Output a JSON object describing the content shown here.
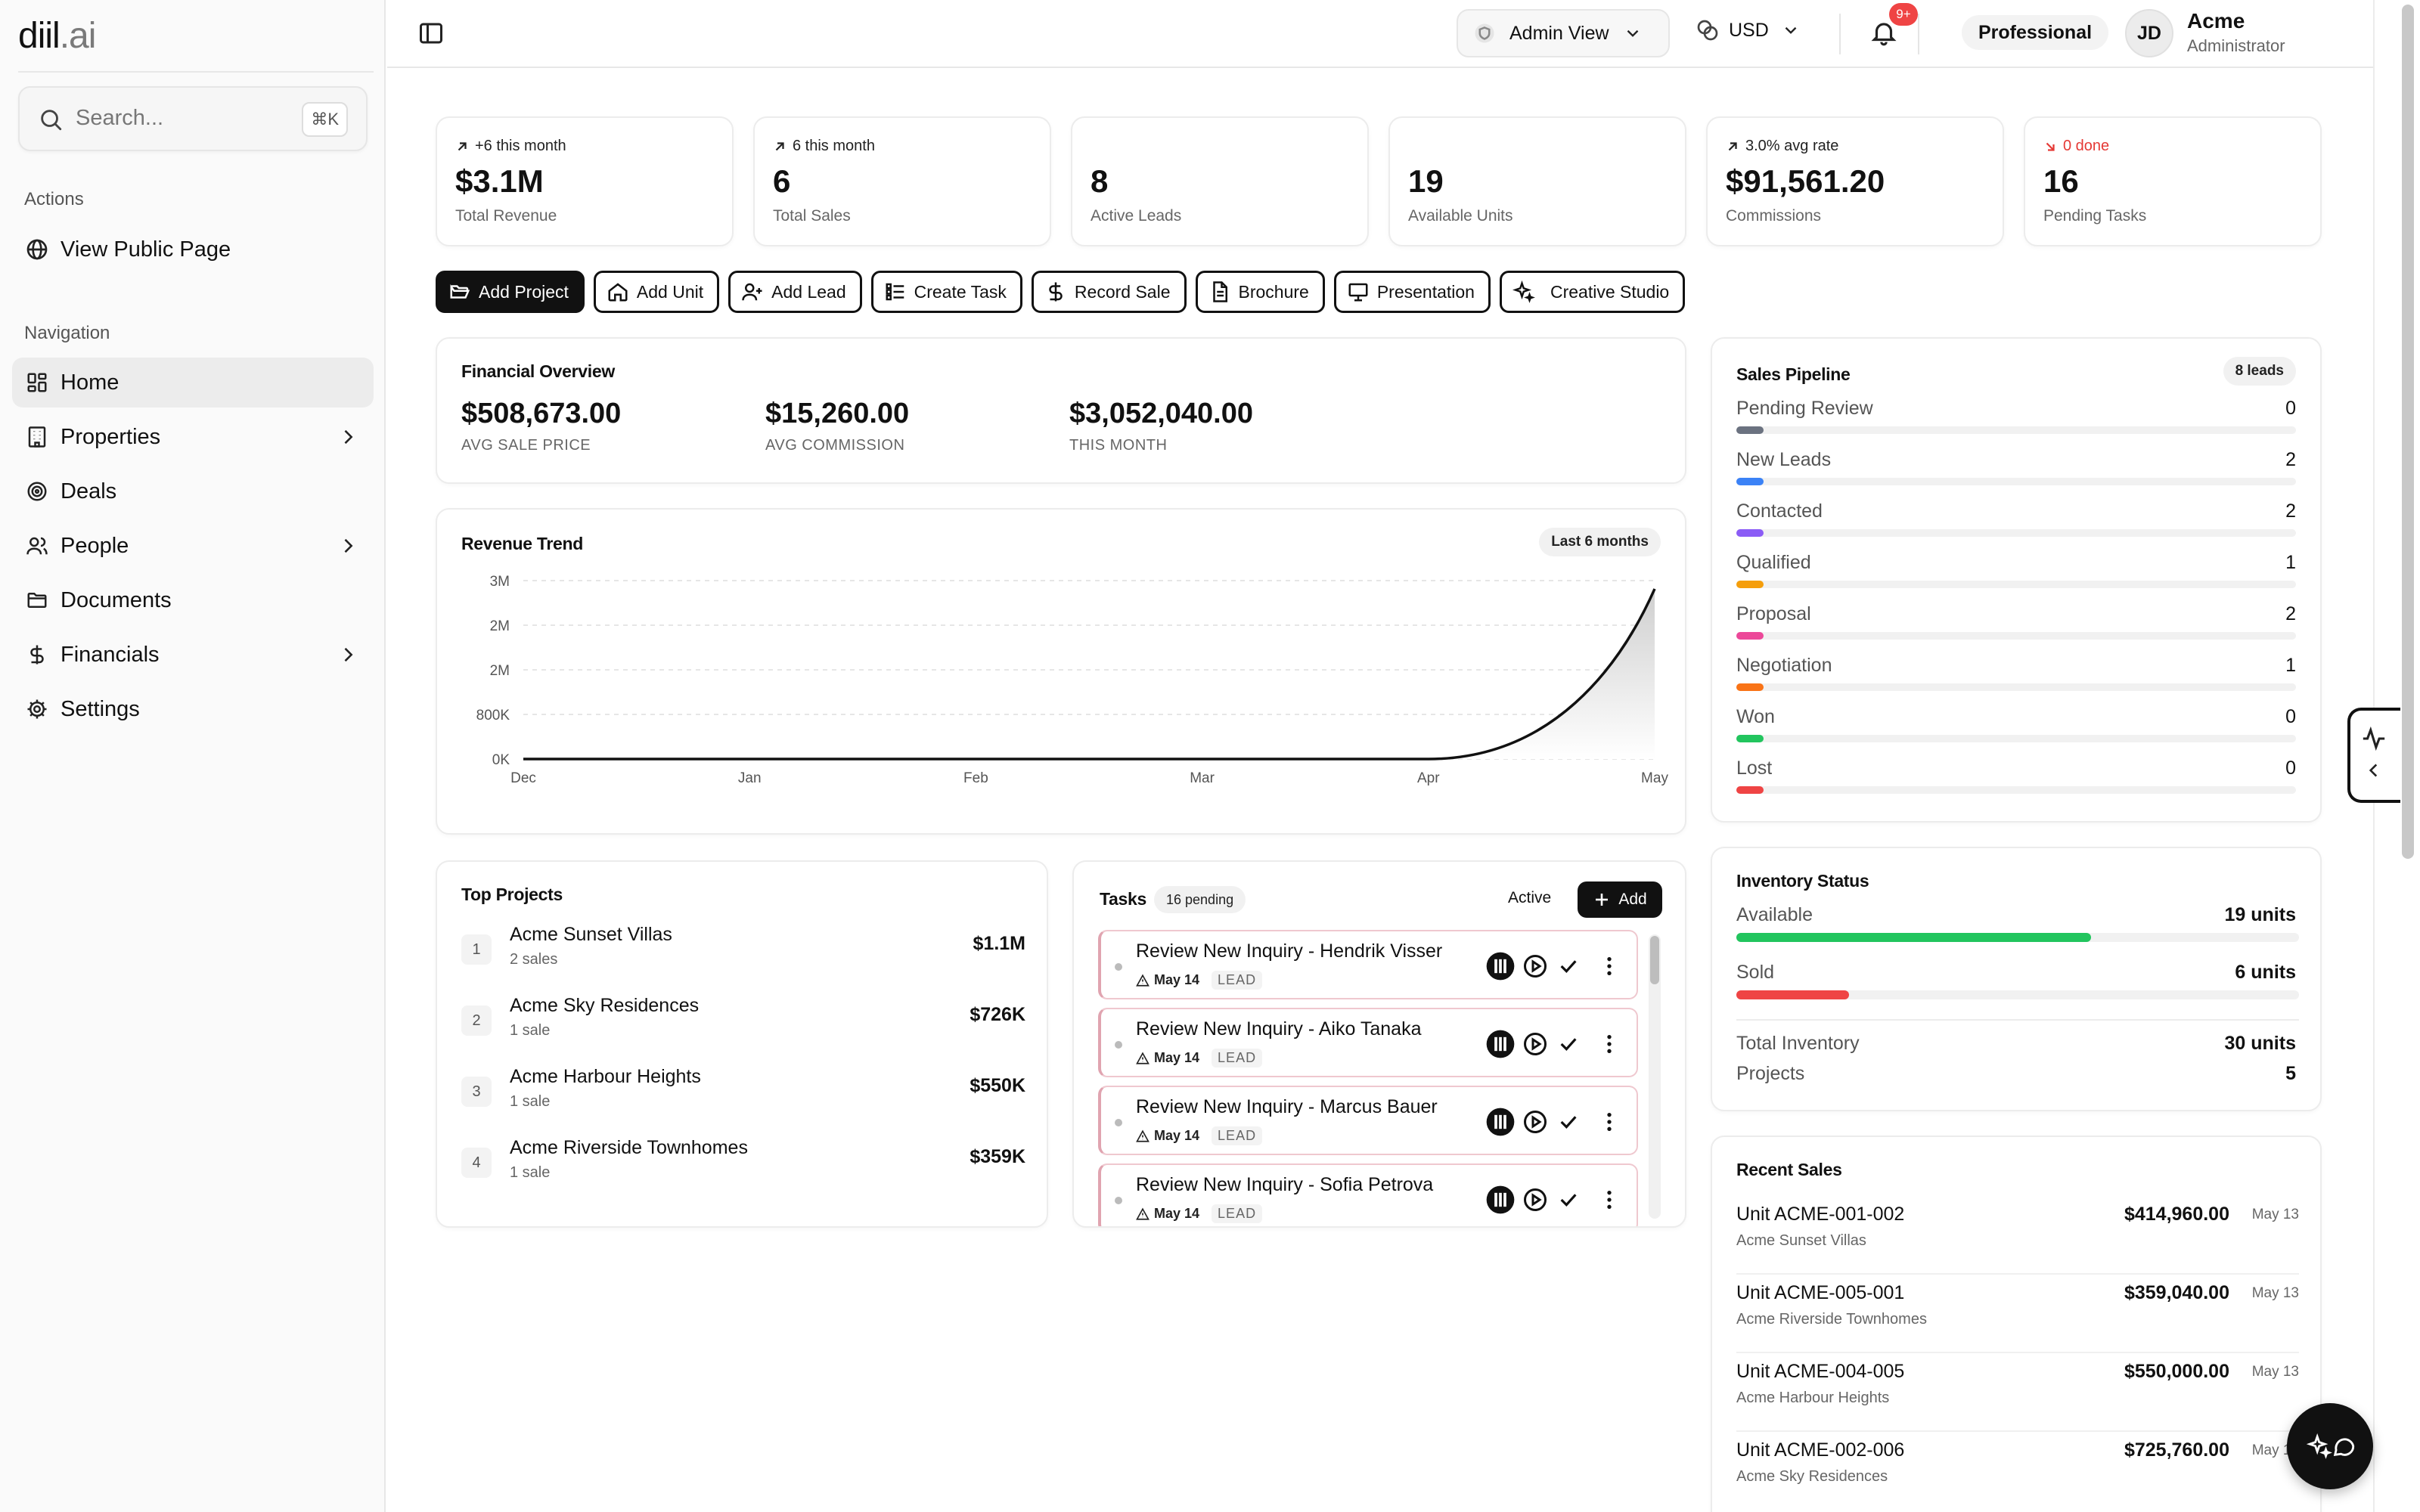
{
  "brand": {
    "name_main": "diil",
    "name_suffix": ".ai"
  },
  "search": {
    "placeholder": "Search...",
    "shortcut": "⌘K"
  },
  "sidebar": {
    "actions_heading": "Actions",
    "actions": [
      {
        "label": "View Public Page",
        "icon": "globe-icon"
      }
    ],
    "navigation_heading": "Navigation",
    "items": [
      {
        "label": "Home",
        "icon": "dashboard-icon",
        "active": true
      },
      {
        "label": "Properties",
        "icon": "building-icon",
        "has_children": true
      },
      {
        "label": "Deals",
        "icon": "target-icon"
      },
      {
        "label": "People",
        "icon": "users-icon",
        "has_children": true
      },
      {
        "label": "Documents",
        "icon": "folder-icon"
      },
      {
        "label": "Financials",
        "icon": "dollar-icon",
        "has_children": true
      },
      {
        "label": "Settings",
        "icon": "gear-icon"
      }
    ]
  },
  "topbar": {
    "view_label": "Admin View",
    "currency": "USD",
    "notifications_badge": "9+",
    "plan": "Professional",
    "user": {
      "initials": "JD",
      "name": "Acme",
      "role": "Administrator"
    }
  },
  "stats": [
    {
      "delta": "+6 this month",
      "value": "$3.1M",
      "label": "Total Revenue",
      "delta_color": "#222222"
    },
    {
      "delta": "6 this month",
      "value": "6",
      "label": "Total Sales",
      "delta_color": "#222222"
    },
    {
      "delta": "",
      "value": "8",
      "label": "Active Leads"
    },
    {
      "delta": "",
      "value": "19",
      "label": "Available Units"
    },
    {
      "delta": "3.0% avg rate",
      "value": "$91,561.20",
      "label": "Commissions",
      "delta_color": "#222222"
    },
    {
      "delta": "0 done",
      "value": "16",
      "label": "Pending Tasks",
      "delta_color": "#e53935"
    }
  ],
  "quick_actions": [
    {
      "label": "Add Project",
      "icon": "folder-open-icon",
      "primary": true
    },
    {
      "label": "Add Unit",
      "icon": "home-icon"
    },
    {
      "label": "Add Lead",
      "icon": "user-plus-icon"
    },
    {
      "label": "Create Task",
      "icon": "list-check-icon"
    },
    {
      "label": "Record Sale",
      "icon": "dollar-icon"
    },
    {
      "label": "Brochure",
      "icon": "document-icon"
    },
    {
      "label": "Presentation",
      "icon": "presentation-icon"
    },
    {
      "label": "Creative Studio",
      "icon": "sparkles-icon"
    }
  ],
  "financial_overview": {
    "title": "Financial Overview",
    "metrics": [
      {
        "value": "$508,673.00",
        "label": "AVG SALE PRICE"
      },
      {
        "value": "$15,260.00",
        "label": "AVG COMMISSION"
      },
      {
        "value": "$3,052,040.00",
        "label": "THIS MONTH"
      }
    ]
  },
  "revenue_trend": {
    "title": "Revenue Trend",
    "range_badge": "Last 6 months"
  },
  "chart_data": {
    "type": "area",
    "title": "Revenue Trend",
    "x": [
      "Dec",
      "Jan",
      "Feb",
      "Mar",
      "Apr",
      "May"
    ],
    "series": [
      {
        "values": [
          0,
          0,
          0,
          0,
          0,
          3052040
        ]
      }
    ],
    "y_tick_labels": [
      "0K",
      "800K",
      "2M",
      "2M",
      "3M"
    ],
    "y_ticks": [
      0,
      800000,
      1600000,
      2400000,
      3200000
    ],
    "ylim": [
      0,
      3200000
    ],
    "grid": true,
    "colors": {
      "line": "#111111",
      "fill_top": "#cfcfcf",
      "fill_bottom": "#ffffff"
    }
  },
  "sales_pipeline": {
    "title": "Sales Pipeline",
    "badge": "8 leads",
    "stages": [
      {
        "label": "Pending Review",
        "count": "0",
        "color": "#6b7280"
      },
      {
        "label": "New Leads",
        "count": "2",
        "color": "#3b82f6"
      },
      {
        "label": "Contacted",
        "count": "2",
        "color": "#8b5cf6"
      },
      {
        "label": "Qualified",
        "count": "1",
        "color": "#f59e0b"
      },
      {
        "label": "Proposal",
        "count": "2",
        "color": "#ec4899"
      },
      {
        "label": "Negotiation",
        "count": "1",
        "color": "#f97316"
      },
      {
        "label": "Won",
        "count": "0",
        "color": "#22c55e"
      },
      {
        "label": "Lost",
        "count": "0",
        "color": "#ef4444"
      }
    ]
  },
  "top_projects": {
    "title": "Top Projects",
    "items": [
      {
        "rank": "1",
        "name": "Acme Sunset Villas",
        "sales": "2 sales",
        "amount": "$1.1M"
      },
      {
        "rank": "2",
        "name": "Acme Sky Residences",
        "sales": "1 sale",
        "amount": "$726K"
      },
      {
        "rank": "3",
        "name": "Acme Harbour Heights",
        "sales": "1 sale",
        "amount": "$550K"
      },
      {
        "rank": "4",
        "name": "Acme Riverside Townhomes",
        "sales": "1 sale",
        "amount": "$359K"
      }
    ]
  },
  "tasks": {
    "title": "Tasks",
    "badge": "16 pending",
    "filter": "Active",
    "add_label": "Add",
    "items": [
      {
        "name": "Review New Inquiry - Hendrik Visser",
        "date": "May 14",
        "tag": "LEAD"
      },
      {
        "name": "Review New Inquiry - Aiko Tanaka",
        "date": "May 14",
        "tag": "LEAD"
      },
      {
        "name": "Review New Inquiry - Marcus Bauer",
        "date": "May 14",
        "tag": "LEAD"
      },
      {
        "name": "Review New Inquiry - Sofia Petrova",
        "date": "May 14",
        "tag": "LEAD"
      }
    ]
  },
  "inventory": {
    "title": "Inventory Status",
    "available_label": "Available",
    "available_value": "19 units",
    "available_fraction": 0.63,
    "available_color": "#22c55e",
    "sold_label": "Sold",
    "sold_value": "6 units",
    "sold_fraction": 0.2,
    "sold_color": "#ef4444",
    "total_label": "Total Inventory",
    "total_value": "30 units",
    "projects_label": "Projects",
    "projects_value": "5"
  },
  "recent_sales": {
    "title": "Recent Sales",
    "items": [
      {
        "unit": "Unit ACME-001-002",
        "project": "Acme Sunset Villas",
        "amount": "$414,960.00",
        "date": "May 13"
      },
      {
        "unit": "Unit ACME-005-001",
        "project": "Acme Riverside Townhomes",
        "amount": "$359,040.00",
        "date": "May 13"
      },
      {
        "unit": "Unit ACME-004-005",
        "project": "Acme Harbour Heights",
        "amount": "$550,000.00",
        "date": "May 13"
      },
      {
        "unit": "Unit ACME-002-006",
        "project": "Acme Sky Residences",
        "amount": "$725,760.00",
        "date": "May 13"
      }
    ]
  }
}
